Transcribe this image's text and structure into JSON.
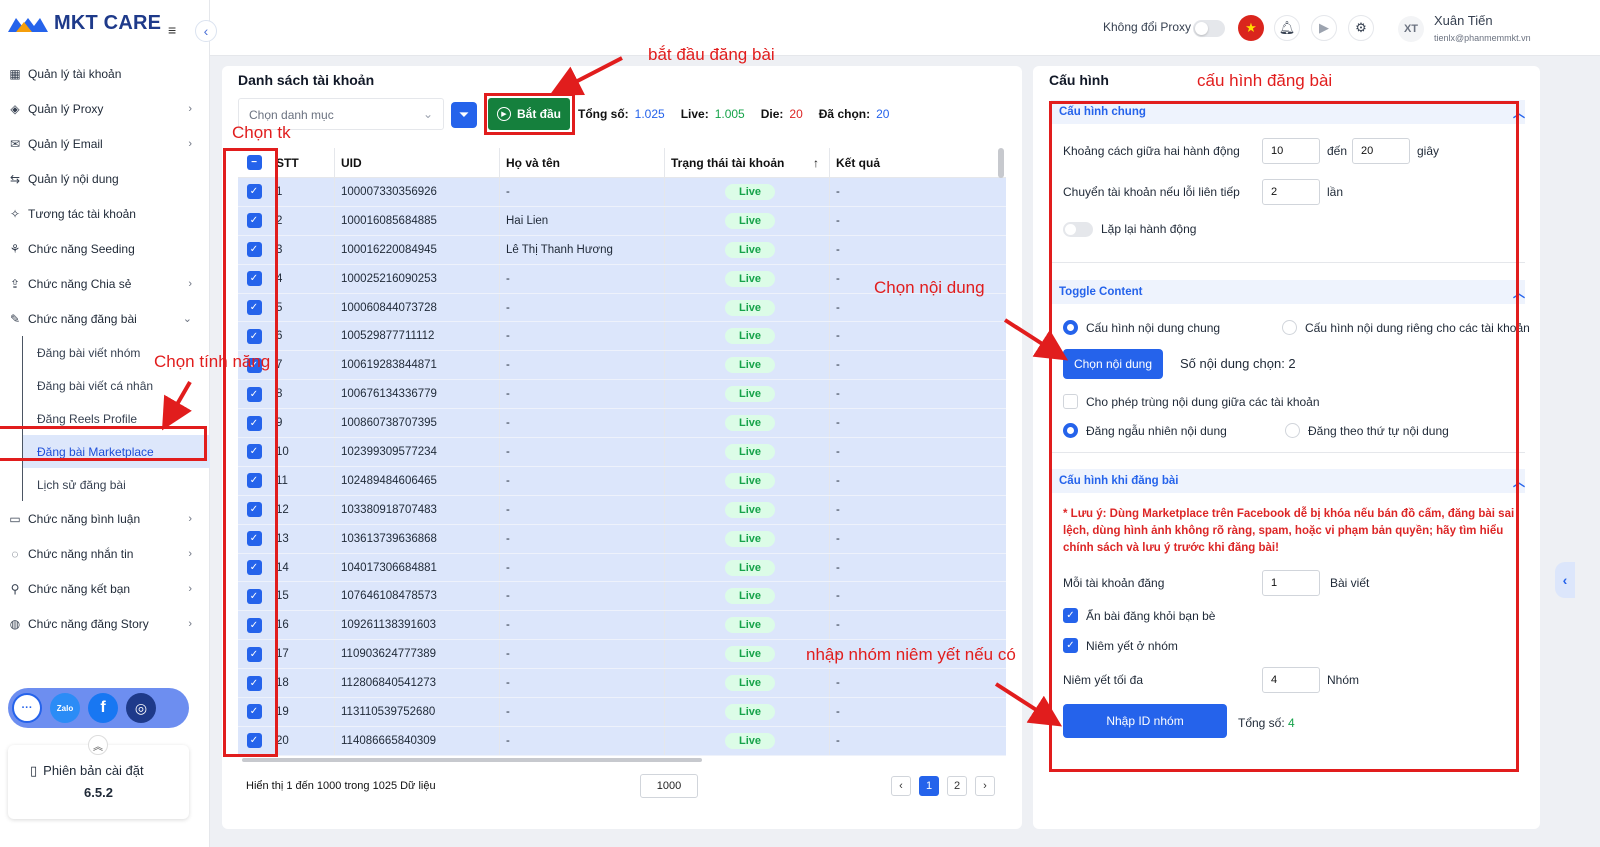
{
  "app": {
    "brand": "MKT CARE"
  },
  "sidebar": {
    "items": [
      {
        "label": "Quản lý tài khoản",
        "icon": "grid-icon",
        "chevron": false
      },
      {
        "label": "Quản lý Proxy",
        "icon": "layers-icon",
        "chevron": true
      },
      {
        "label": "Quản lý Email",
        "icon": "mail-icon",
        "chevron": true
      },
      {
        "label": "Quản lý nội dung",
        "icon": "content-icon",
        "chevron": false
      },
      {
        "label": "Tương tác tài khoản",
        "icon": "sparkle-icon",
        "chevron": false
      },
      {
        "label": "Chức năng Seeding",
        "icon": "seeding-icon",
        "chevron": false
      },
      {
        "label": "Chức năng Chia sẻ",
        "icon": "share-icon",
        "chevron": true
      },
      {
        "label": "Chức năng đăng bài",
        "icon": "post-icon",
        "chevron": true,
        "expanded": true
      }
    ],
    "sub_items": [
      {
        "label": "Đăng bài viết nhóm"
      },
      {
        "label": "Đăng bài viết cá nhân"
      },
      {
        "label": "Đăng Reels Profile"
      },
      {
        "label": "Đăng bài Marketplace",
        "active": true
      },
      {
        "label": "Lịch sử đăng bài"
      }
    ],
    "items_after": [
      {
        "label": "Chức năng bình luận",
        "icon": "comment-icon",
        "chevron": true
      },
      {
        "label": "Chức năng nhắn tin",
        "icon": "chat-icon",
        "chevron": true
      },
      {
        "label": "Chức năng kết bạn",
        "icon": "add-friend-icon",
        "chevron": true
      },
      {
        "label": "Chức năng đăng Story",
        "icon": "story-icon",
        "chevron": true
      }
    ],
    "version_label": "Phiên bản cài đặt",
    "version": "6.5.2"
  },
  "header": {
    "proxy_label": "Không đổi Proxy",
    "user_initials": "XT",
    "user_name": "Xuân Tiến",
    "user_email": "tienlx@phanmemmkt.vn"
  },
  "accounts": {
    "title": "Danh sách tài khoản",
    "category_placeholder": "Chọn danh mục",
    "start_label": "Bắt đầu",
    "stats": {
      "total_label": "Tổng số:",
      "total": "1.025",
      "live_label": "Live:",
      "live": "1.005",
      "die_label": "Die:",
      "die": "20",
      "selected_label": "Đã chọn:",
      "selected": "20"
    },
    "columns": {
      "stt": "STT",
      "uid": "UID",
      "name": "Họ và tên",
      "status": "Trạng thái tài khoản",
      "result": "Kết quả"
    },
    "rows": [
      {
        "stt": "1",
        "uid": "100007330356926",
        "name": "-",
        "status": "Live",
        "result": "-"
      },
      {
        "stt": "2",
        "uid": "100016085684885",
        "name": "Hai Lien",
        "status": "Live",
        "result": "-"
      },
      {
        "stt": "3",
        "uid": "100016220084945",
        "name": "Lê Thị Thanh Hương",
        "status": "Live",
        "result": "-"
      },
      {
        "stt": "4",
        "uid": "100025216090253",
        "name": "-",
        "status": "Live",
        "result": "-"
      },
      {
        "stt": "5",
        "uid": "100060844073728",
        "name": "-",
        "status": "Live",
        "result": "-"
      },
      {
        "stt": "6",
        "uid": "100529877711112",
        "name": "-",
        "status": "Live",
        "result": "-"
      },
      {
        "stt": "7",
        "uid": "100619283844871",
        "name": "-",
        "status": "Live",
        "result": "-"
      },
      {
        "stt": "8",
        "uid": "100676134336779",
        "name": "-",
        "status": "Live",
        "result": "-"
      },
      {
        "stt": "9",
        "uid": "100860738707395",
        "name": "-",
        "status": "Live",
        "result": "-"
      },
      {
        "stt": "10",
        "uid": "102399309577234",
        "name": "-",
        "status": "Live",
        "result": "-"
      },
      {
        "stt": "11",
        "uid": "102489484606465",
        "name": "-",
        "status": "Live",
        "result": "-"
      },
      {
        "stt": "12",
        "uid": "103380918707483",
        "name": "-",
        "status": "Live",
        "result": "-"
      },
      {
        "stt": "13",
        "uid": "103613739636868",
        "name": "-",
        "status": "Live",
        "result": "-"
      },
      {
        "stt": "14",
        "uid": "104017306684881",
        "name": "-",
        "status": "Live",
        "result": "-"
      },
      {
        "stt": "15",
        "uid": "107646108478573",
        "name": "-",
        "status": "Live",
        "result": "-"
      },
      {
        "stt": "16",
        "uid": "109261138391603",
        "name": "-",
        "status": "Live",
        "result": "-"
      },
      {
        "stt": "17",
        "uid": "110903624777389",
        "name": "-",
        "status": "Live",
        "result": "-"
      },
      {
        "stt": "18",
        "uid": "112806840541273",
        "name": "-",
        "status": "Live",
        "result": "-"
      },
      {
        "stt": "19",
        "uid": "113110539752680",
        "name": "-",
        "status": "Live",
        "result": "-"
      },
      {
        "stt": "20",
        "uid": "114086665840309",
        "name": "-",
        "status": "Live",
        "result": "-"
      }
    ],
    "footer_text": "Hiển thị 1 đến 1000 trong 1025 Dữ liệu",
    "per_page": "1000",
    "pages": [
      "1",
      "2"
    ]
  },
  "config": {
    "title": "Cấu hình",
    "general": {
      "header": "Cấu hình chung",
      "delay_label": "Khoảng cách giữa hai hành động",
      "delay_from": "10",
      "to_label": "đến",
      "delay_to": "20",
      "seconds": "giây",
      "switch_label": "Chuyển tài khoản nếu lỗi liên tiếp",
      "switch_value": "2",
      "times": "lần",
      "repeat_label": "Lặp lại hành động"
    },
    "content": {
      "header": "Toggle Content",
      "opt_common": "Cấu hình nội dung chung",
      "opt_per_account": "Cấu hình nội dung riêng cho các tài khoản",
      "choose_button": "Chọn nội dung",
      "count_text": "Số nội dung chọn: 2",
      "allow_duplicate": "Cho phép trùng nội dung giữa các tài khoản",
      "random_order": "Đăng ngẫu nhiên nội dung",
      "sequential_order": "Đăng theo thứ tự nội dung"
    },
    "posting": {
      "header": "Cấu hình khi đăng bài",
      "warning": "* Lưu ý: Dùng Marketplace trên Facebook dễ bị khóa nếu bán đồ cấm, đăng bài sai lệch, dùng hình ảnh không rõ ràng, spam, hoặc vi phạm bản quyền; hãy tìm hiểu chính sách và lưu ý trước khi đăng bài!",
      "per_account_label": "Mỗi tài khoản đăng",
      "per_account_value": "1",
      "posts_unit": "Bài viết",
      "hide_from_friends": "Ẩn bài đăng khỏi bạn bè",
      "list_in_groups": "Niêm yết ở nhóm",
      "max_groups_label": "Niêm yết tối đa",
      "max_groups_value": "4",
      "groups_unit": "Nhóm",
      "import_button": "Nhập ID nhóm",
      "total_label": "Tổng số:",
      "total_value": "4"
    }
  },
  "annotations": {
    "start": "bắt đầu đăng bài",
    "config": "cấu hình đăng bài",
    "choose_account": "Chọn tk",
    "choose_feature": "Chọn tính năng",
    "choose_content": "Chọn nội dung",
    "group_input": "nhập nhóm niêm yết nếu có"
  },
  "colors": {
    "accent": "#2563eb",
    "annotation": "#e11d1d",
    "start_green": "#15803d",
    "live_green": "#16a34a"
  }
}
